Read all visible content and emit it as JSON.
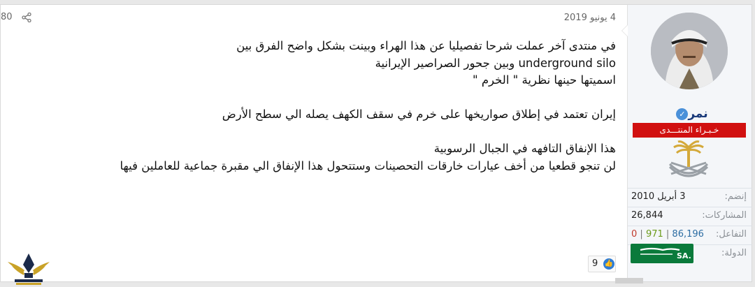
{
  "post": {
    "date": "4 يونيو 2019",
    "top_count": "80",
    "paragraphs": [
      [
        "في منتدى آخر عملت شرحا تفصيليا عن هذا الهراء وبينت بشكل واضح الفرق بين",
        "underground silo وبين جحور الصراصير الإيرانية",
        "اسميتها حينها نظرية \" الخرم \""
      ],
      [
        "إيران تعتمد في إطلاق صواريخها على خرم في سقف الكهف يصله الي سطح الأرض"
      ],
      [
        "هذا الإنفاق التافهه في الجبال الرسوبية",
        "لن تنجو قطعيا من أخف عيارات خارقات التحصينات وستتحول هذا الإنفاق الي مقبرة جماعية للعاملين فيها"
      ]
    ],
    "reaction_count": "9"
  },
  "user": {
    "name": "نمر",
    "rank": "خـبـراء المنتـــدى",
    "info": {
      "joined_label": "إنضم:",
      "joined_value": "3 أبريل 2010",
      "posts_label": "المشاركات:",
      "posts_value": "26,844",
      "interaction_label": "التفاعل:",
      "interaction_positive": "86,196",
      "interaction_points": "971",
      "interaction_negative": "0",
      "country_label": "الدولة:",
      "country_flag_text": "SA."
    }
  },
  "colors": {
    "rank_bg": "#d11010",
    "username": "#1a3a7a",
    "verified": "#4a90d9",
    "flag": "#0a7a3b"
  },
  "icons": {
    "share": "share-icon",
    "like": "thumbs-up-icon",
    "verified": "verified-check-icon",
    "emblem": "saudi-emblem-icon"
  }
}
